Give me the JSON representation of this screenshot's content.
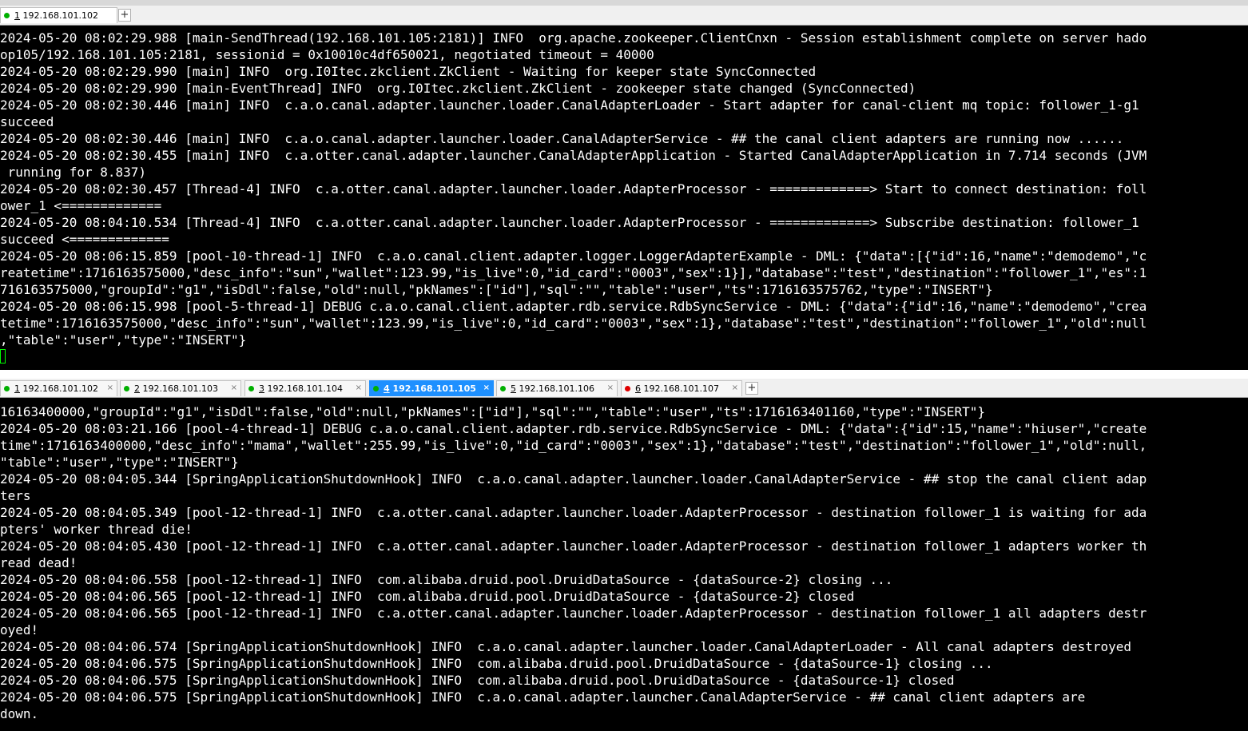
{
  "top_tabs": [
    {
      "num": "1",
      "host": "192.168.101.102",
      "status": "green"
    }
  ],
  "bottom_tabs": [
    {
      "num": "1",
      "host": "192.168.101.102",
      "status": "green"
    },
    {
      "num": "2",
      "host": "192.168.101.103",
      "status": "green"
    },
    {
      "num": "3",
      "host": "192.168.101.104",
      "status": "green"
    },
    {
      "num": "4",
      "host": "192.168.101.105",
      "status": "green",
      "active": true
    },
    {
      "num": "5",
      "host": "192.168.101.106",
      "status": "green"
    },
    {
      "num": "6",
      "host": "192.168.101.107",
      "status": "red"
    }
  ],
  "add_tab_label": "+",
  "close_label": "×",
  "colors": {
    "green": "#00b000",
    "red": "#e00000",
    "active_tab": "#1e90ff",
    "cursor": "#00ff00"
  },
  "pane1": {
    "lines": [
      "2024-05-20 08:02:29.988 [main-SendThread(192.168.101.105:2181)] INFO  org.apache.zookeeper.ClientCnxn - Session establishment complete on server hado",
      "op105/192.168.101.105:2181, sessionid = 0x10010c4df650021, negotiated timeout = 40000",
      "2024-05-20 08:02:29.990 [main] INFO  org.I0Itec.zkclient.ZkClient - Waiting for keeper state SyncConnected",
      "2024-05-20 08:02:29.990 [main-EventThread] INFO  org.I0Itec.zkclient.ZkClient - zookeeper state changed (SyncConnected)",
      "2024-05-20 08:02:30.446 [main] INFO  c.a.o.canal.adapter.launcher.loader.CanalAdapterLoader - Start adapter for canal-client mq topic: follower_1-g1",
      "succeed",
      "2024-05-20 08:02:30.446 [main] INFO  c.a.o.canal.adapter.launcher.loader.CanalAdapterService - ## the canal client adapters are running now ......",
      "2024-05-20 08:02:30.455 [main] INFO  c.a.otter.canal.adapter.launcher.CanalAdapterApplication - Started CanalAdapterApplication in 7.714 seconds (JVM",
      " running for 8.837)",
      "2024-05-20 08:02:30.457 [Thread-4] INFO  c.a.otter.canal.adapter.launcher.loader.AdapterProcessor - =============> Start to connect destination: foll",
      "ower_1 <=============",
      "2024-05-20 08:04:10.534 [Thread-4] INFO  c.a.otter.canal.adapter.launcher.loader.AdapterProcessor - =============> Subscribe destination: follower_1",
      "succeed <=============",
      "2024-05-20 08:06:15.859 [pool-10-thread-1] INFO  c.a.o.canal.client.adapter.logger.LoggerAdapterExample - DML: {\"data\":[{\"id\":16,\"name\":\"demodemo\",\"c",
      "reatetime\":1716163575000,\"desc_info\":\"sun\",\"wallet\":123.99,\"is_live\":0,\"id_card\":\"0003\",\"sex\":1}],\"database\":\"test\",\"destination\":\"follower_1\",\"es\":1",
      "716163575000,\"groupId\":\"g1\",\"isDdl\":false,\"old\":null,\"pkNames\":[\"id\"],\"sql\":\"\",\"table\":\"user\",\"ts\":1716163575762,\"type\":\"INSERT\"}",
      "2024-05-20 08:06:15.998 [pool-5-thread-1] DEBUG c.a.o.canal.client.adapter.rdb.service.RdbSyncService - DML: {\"data\":{\"id\":16,\"name\":\"demodemo\",\"crea",
      "tetime\":1716163575000,\"desc_info\":\"sun\",\"wallet\":123.99,\"is_live\":0,\"id_card\":\"0003\",\"sex\":1},\"database\":\"test\",\"destination\":\"follower_1\",\"old\":null",
      ",\"table\":\"user\",\"type\":\"INSERT\"}"
    ]
  },
  "pane2": {
    "lines": [
      "16163400000,\"groupId\":\"g1\",\"isDdl\":false,\"old\":null,\"pkNames\":[\"id\"],\"sql\":\"\",\"table\":\"user\",\"ts\":1716163401160,\"type\":\"INSERT\"}",
      "2024-05-20 08:03:21.166 [pool-4-thread-1] DEBUG c.a.o.canal.client.adapter.rdb.service.RdbSyncService - DML: {\"data\":{\"id\":15,\"name\":\"hiuser\",\"create",
      "time\":1716163400000,\"desc_info\":\"mama\",\"wallet\":255.99,\"is_live\":0,\"id_card\":\"0003\",\"sex\":1},\"database\":\"test\",\"destination\":\"follower_1\",\"old\":null,",
      "\"table\":\"user\",\"type\":\"INSERT\"}",
      "2024-05-20 08:04:05.344 [SpringApplicationShutdownHook] INFO  c.a.o.canal.adapter.launcher.loader.CanalAdapterService - ## stop the canal client adap",
      "ters",
      "2024-05-20 08:04:05.349 [pool-12-thread-1] INFO  c.a.otter.canal.adapter.launcher.loader.AdapterProcessor - destination follower_1 is waiting for ada",
      "pters' worker thread die!",
      "2024-05-20 08:04:05.430 [pool-12-thread-1] INFO  c.a.otter.canal.adapter.launcher.loader.AdapterProcessor - destination follower_1 adapters worker th",
      "read dead!",
      "2024-05-20 08:04:06.558 [pool-12-thread-1] INFO  com.alibaba.druid.pool.DruidDataSource - {dataSource-2} closing ...",
      "2024-05-20 08:04:06.565 [pool-12-thread-1] INFO  com.alibaba.druid.pool.DruidDataSource - {dataSource-2} closed",
      "2024-05-20 08:04:06.565 [pool-12-thread-1] INFO  c.a.otter.canal.adapter.launcher.loader.AdapterProcessor - destination follower_1 all adapters destr",
      "oyed!",
      "2024-05-20 08:04:06.574 [SpringApplicationShutdownHook] INFO  c.a.o.canal.adapter.launcher.loader.CanalAdapterLoader - All canal adapters destroyed",
      "2024-05-20 08:04:06.575 [SpringApplicationShutdownHook] INFO  com.alibaba.druid.pool.DruidDataSource - {dataSource-1} closing ...",
      "2024-05-20 08:04:06.575 [SpringApplicationShutdownHook] INFO  com.alibaba.druid.pool.DruidDataSource - {dataSource-1} closed",
      "2024-05-20 08:04:06.575 [SpringApplicationShutdownHook] INFO  c.a.o.canal.adapter.launcher.CanalAdapterService - ## canal client adapters are",
      "down."
    ]
  }
}
